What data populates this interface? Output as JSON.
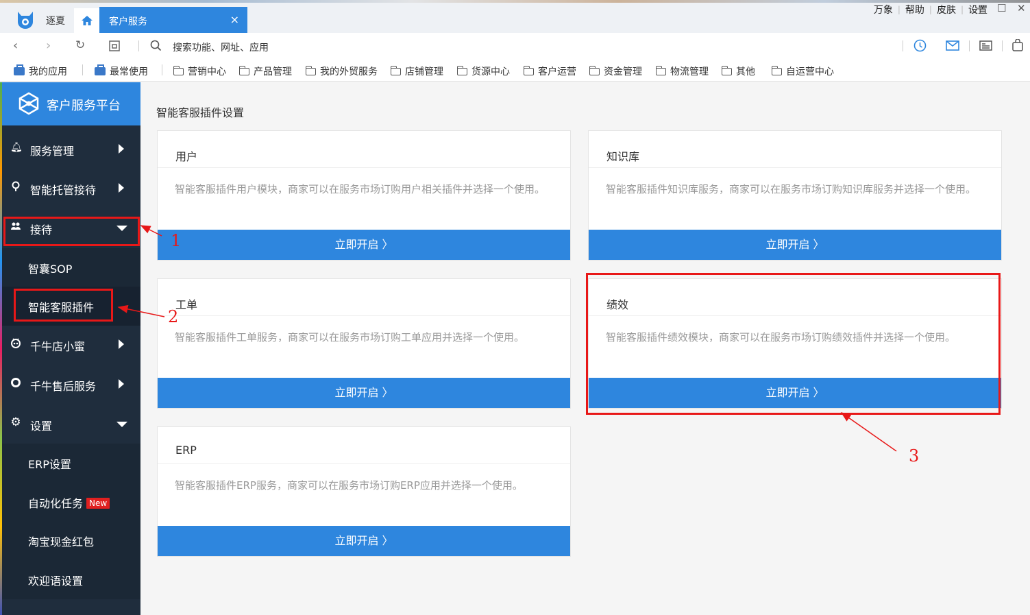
{
  "titlebar": {
    "app_name": "逐夏",
    "active_tab": "客户服务",
    "close_glyph": "×",
    "links": [
      "万象",
      "帮助",
      "皮肤",
      "设置"
    ]
  },
  "addressbar": {
    "placeholder": "搜索功能、网址、应用"
  },
  "bookmarks": {
    "my_apps": "我的应用",
    "frequent": "最常使用",
    "folders": [
      "营销中心",
      "产品管理",
      "我的外贸服务",
      "店铺管理",
      "货源中心",
      "客户运营",
      "资金管理",
      "物流管理",
      "其他",
      "自运营中心"
    ]
  },
  "sidebar": {
    "title": "客户服务平台",
    "items": {
      "service": "服务管理",
      "hosting": "智能托管接待",
      "reception": "接待",
      "sop": "智囊SOP",
      "plugin": "智能客服插件",
      "xiaomi": "千牛店小蜜",
      "aftersale": "千牛售后服务",
      "settings": "设置",
      "erp": "ERP设置",
      "auto": "自动化任务",
      "new_badge": "New",
      "redpack": "淘宝现金红包",
      "welcome": "欢迎语设置"
    }
  },
  "main": {
    "title": "智能客服插件设置",
    "button_label": "立即开启 〉",
    "cards": [
      {
        "title": "用户",
        "desc": "智能客服插件用户模块，商家可以在服务市场订购用户相关插件并选择一个使用。"
      },
      {
        "title": "知识库",
        "desc": "智能客服插件知识库服务，商家可以在服务市场订购知识库服务并选择一个使用。"
      },
      {
        "title": "工单",
        "desc": "智能客服插件工单服务，商家可以在服务市场订购工单应用并选择一个使用。"
      },
      {
        "title": "绩效",
        "desc": "智能客服插件绩效模块，商家可以在服务市场订购绩效插件并选择一个使用。"
      },
      {
        "title": "ERP",
        "desc": "智能客服插件ERP服务，商家可以在服务市场订购ERP应用并选择一个使用。"
      }
    ]
  },
  "annotations": {
    "n1": "1",
    "n2": "2",
    "n3": "3",
    "color": "#e81818"
  },
  "colors": {
    "accent": "#2e86de",
    "sidebar_bg": "#1f2d3d"
  }
}
